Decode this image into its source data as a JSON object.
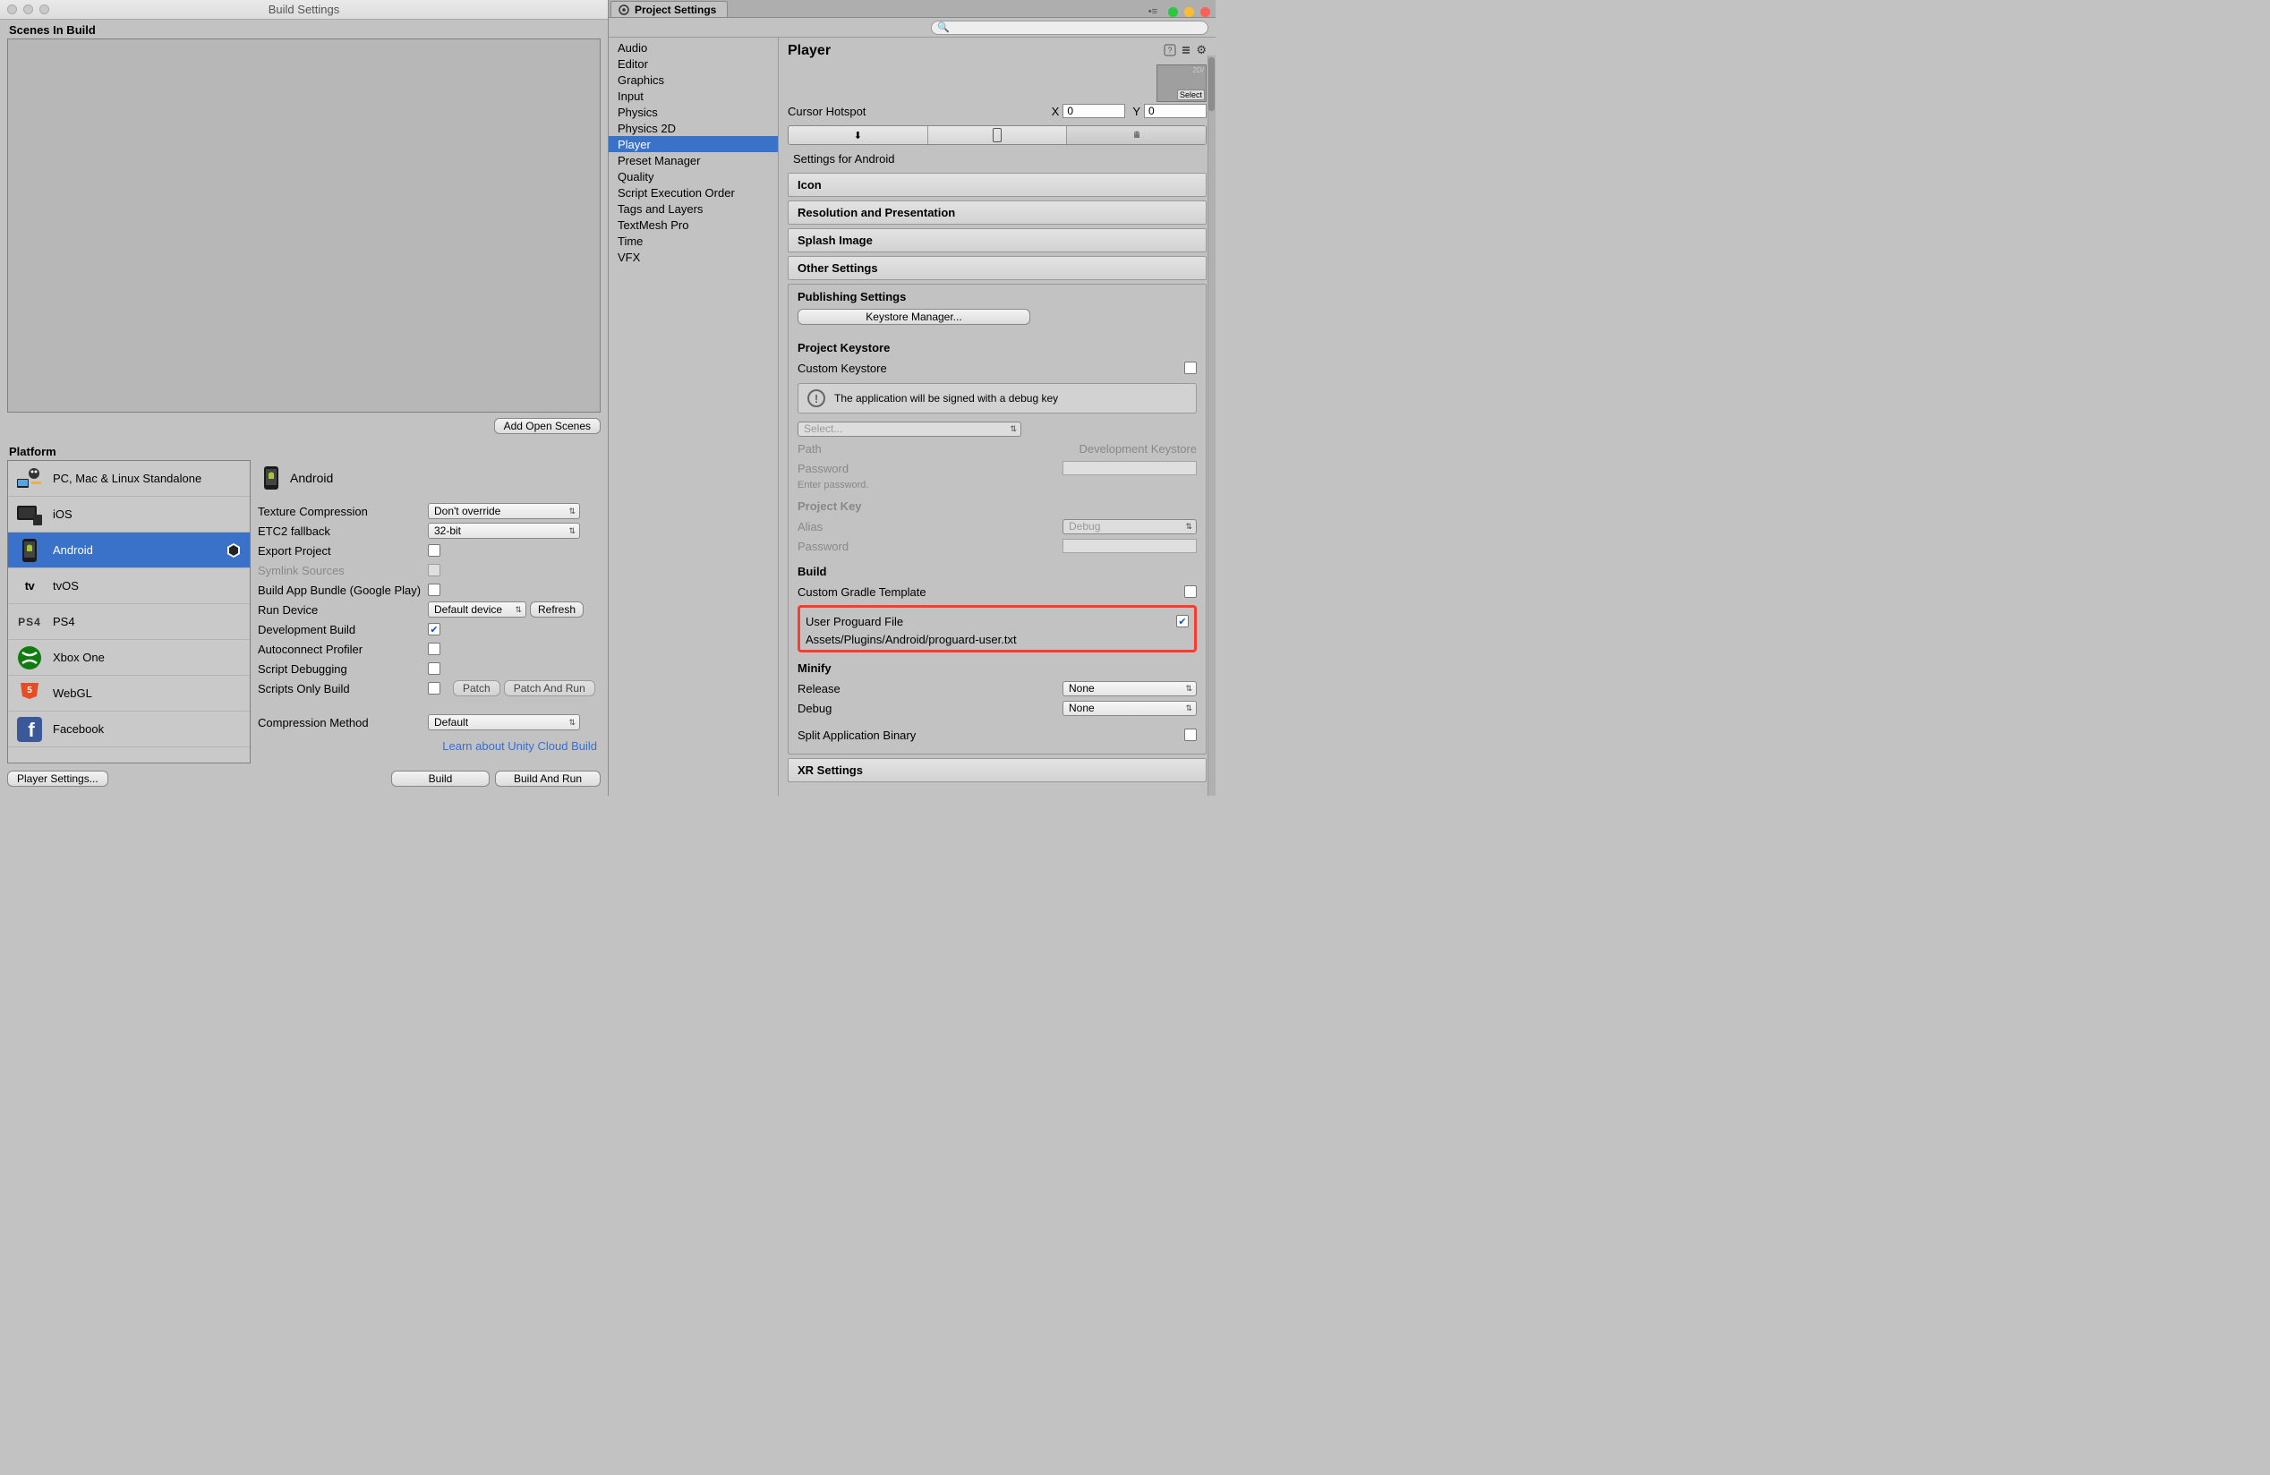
{
  "buildWindow": {
    "title": "Build Settings",
    "scenesHeader": "Scenes In Build",
    "addOpenScenes": "Add Open Scenes",
    "platformHeader": "Platform",
    "platforms": [
      {
        "label": "PC, Mac & Linux Standalone"
      },
      {
        "label": "iOS"
      },
      {
        "label": "Android"
      },
      {
        "label": "tvOS"
      },
      {
        "label": "PS4"
      },
      {
        "label": "Xbox One"
      },
      {
        "label": "WebGL"
      },
      {
        "label": "Facebook"
      }
    ],
    "currentPlatform": "Android",
    "options": {
      "textureCompression": {
        "label": "Texture Compression",
        "value": "Don't override"
      },
      "etc2": {
        "label": "ETC2 fallback",
        "value": "32-bit"
      },
      "exportProject": {
        "label": "Export Project",
        "checked": false
      },
      "symlink": {
        "label": "Symlink Sources",
        "checked": false
      },
      "appBundle": {
        "label": "Build App Bundle (Google Play)",
        "checked": false
      },
      "runDevice": {
        "label": "Run Device",
        "value": "Default device",
        "refresh": "Refresh"
      },
      "devBuild": {
        "label": "Development Build",
        "checked": true
      },
      "autoconnect": {
        "label": "Autoconnect Profiler",
        "checked": false
      },
      "scriptDebug": {
        "label": "Script Debugging",
        "checked": false
      },
      "scriptsOnly": {
        "label": "Scripts Only Build",
        "checked": false,
        "patch": "Patch",
        "patchRun": "Patch And Run"
      },
      "compression": {
        "label": "Compression Method",
        "value": "Default"
      }
    },
    "cloudLink": "Learn about Unity Cloud Build",
    "playerSettingsBtn": "Player Settings...",
    "buildBtn": "Build",
    "buildRunBtn": "Build And Run"
  },
  "projWindow": {
    "tabLabel": "Project Settings",
    "searchPlaceholder": "",
    "categories": [
      "Audio",
      "Editor",
      "Graphics",
      "Input",
      "Physics",
      "Physics 2D",
      "Player",
      "Preset Manager",
      "Quality",
      "Script Execution Order",
      "Tags and Layers",
      "TextMesh Pro",
      "Time",
      "VFX"
    ],
    "selectedCategory": "Player",
    "inspector": {
      "title": "Player",
      "preview2d": "2D/",
      "selectBtn": "Select",
      "cursorHotspot": "Cursor Hotspot",
      "cursorX": "0",
      "cursorY": "0",
      "settingsFor": "Settings for Android",
      "foldouts": [
        "Icon",
        "Resolution and Presentation",
        "Splash Image",
        "Other Settings"
      ],
      "publishing": {
        "title": "Publishing Settings",
        "keystoreManager": "Keystore Manager...",
        "projectKeystore": "Project Keystore",
        "customKeystore": {
          "label": "Custom Keystore",
          "checked": false
        },
        "infoMsg": "The application will be signed with a debug key",
        "selectDropdown": "Select...",
        "path": {
          "label": "Path",
          "value": "Development Keystore"
        },
        "password": {
          "label": "Password",
          "hint": "Enter password."
        },
        "projectKey": "Project Key",
        "alias": {
          "label": "Alias",
          "value": "Debug"
        },
        "aliasPassword": "Password",
        "build": "Build",
        "customGradle": {
          "label": "Custom Gradle Template",
          "checked": false
        },
        "userProguard": {
          "label": "User Proguard File",
          "checked": true,
          "path": "Assets/Plugins/Android/proguard-user.txt"
        },
        "minify": "Minify",
        "release": {
          "label": "Release",
          "value": "None"
        },
        "debug": {
          "label": "Debug",
          "value": "None"
        },
        "splitBinary": {
          "label": "Split Application Binary",
          "checked": false
        }
      },
      "xrSettings": "XR Settings"
    }
  }
}
